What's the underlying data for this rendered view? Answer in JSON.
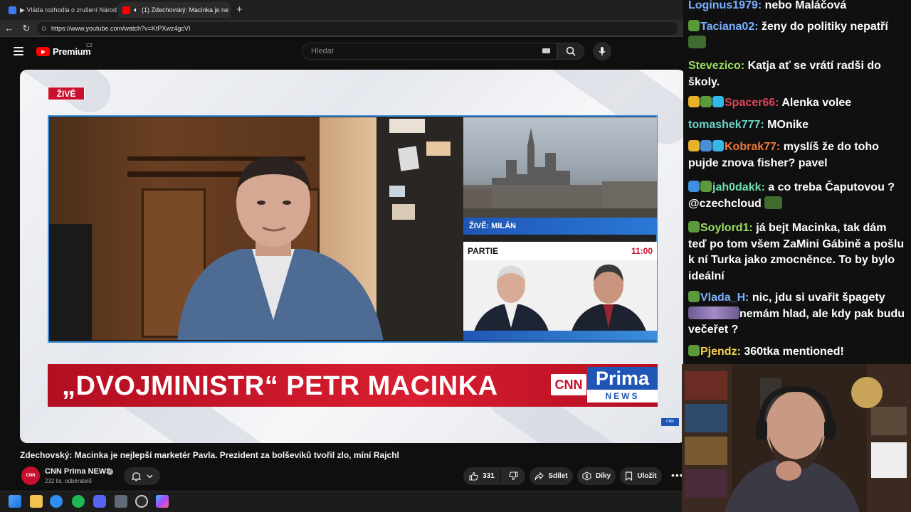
{
  "browser": {
    "tabs": [
      {
        "title": "▶ Vláda rozhodla o zrušení Národ"
      },
      {
        "title": "(1) Zdechovský: Macinka je ne"
      }
    ],
    "url": "https://www.youtube.com/watch?v=KtPXwz4gcVI"
  },
  "youtube": {
    "brand": "Premium",
    "country": "CZ",
    "search_placeholder": "Hledat"
  },
  "video": {
    "live_badge": "ŽIVĚ",
    "city_label": "ŽIVĚ: MILÁN",
    "program_name": "PARTIE",
    "program_time": "11:00",
    "headline": "„DVOJMINISTR“ PETR MACINKA",
    "cnn_logo": "CNN",
    "prima_logo_top": "Prima",
    "prima_logo_bottom": "NEWS",
    "watermark": "CNN Prima",
    "title": "Zdechovský: Macinka je nejlepší marketér Pavla. Prezident za bolševiků tvořil zlo, míní Rajchl"
  },
  "channel": {
    "avatar_text": "CNN Prima",
    "name": "CNN Prima NEWS",
    "subscribers": "232 tis. odběratelů"
  },
  "actions": {
    "likes": "331",
    "share": "Sdílet",
    "thanks": "Díky",
    "save": "Uložit"
  },
  "chat": {
    "messages": [
      {
        "user": "Loginus1979",
        "color": "#7ab0ff",
        "text": "nebo Maláčová"
      },
      {
        "user": "Taciana02",
        "color": "#7ab0ff",
        "text": "ženy do politiky nepatří"
      },
      {
        "user": "Stevezico",
        "color": "#9be15d",
        "text": "Katja ať se vrátí radši do školy."
      },
      {
        "user": "Spacer66",
        "color": "#e0445a",
        "text": "Alenka volee"
      },
      {
        "user": "tomashek777",
        "color": "#6cd6c8",
        "text": "MOnike"
      },
      {
        "user": "Kobrak77",
        "color": "#f07a3a",
        "text": "myslíš že do toho pujde znova fisher? pavel"
      },
      {
        "user": "jah0dakk",
        "color": "#6ce3b0",
        "text": "a co treba Čaputovou ? @czechcloud"
      },
      {
        "user": "Soylord1",
        "color": "#9be15d",
        "text": "já bejt Macinka, tak dám teď po tom všem ZaMini Gábině a pošlu k ní Turka jako zmocněnce. To by bylo ideální"
      },
      {
        "user": "Vlada_H",
        "color": "#7ab0ff",
        "text_a": "nic, jdu si uvařit špagety",
        "text_b": "nemám hlad, ale kdy pak budu večeřet ?"
      },
      {
        "user": "Pjendz",
        "color": "#f5d04a",
        "text": "360tka mentioned!"
      }
    ]
  },
  "colors": {
    "accent_red": "#c8102e",
    "accent_blue": "#1f56b6",
    "youtube_red": "#ff0000"
  }
}
